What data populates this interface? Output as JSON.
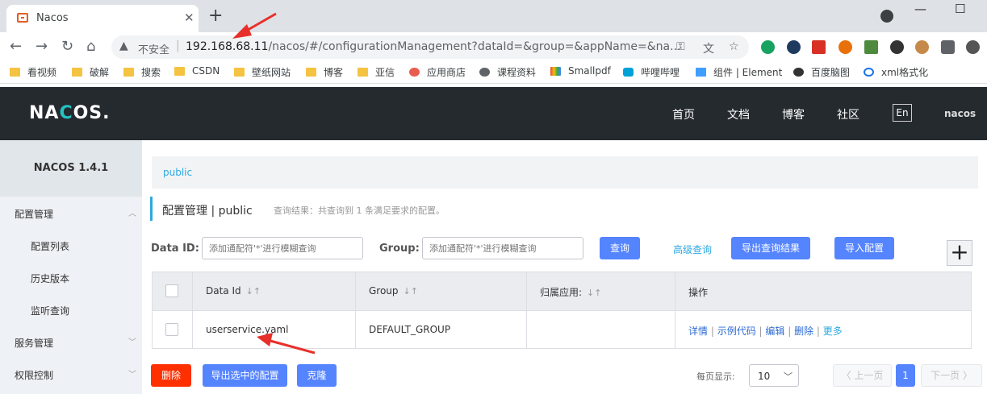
{
  "browser": {
    "tab_title": "Nacos",
    "tab_close": "✕",
    "new_tab": "+",
    "win_min": "—",
    "win_max": "☐",
    "nav": {
      "back": "←",
      "forward": "→",
      "reload": "↻",
      "home": "⌂"
    },
    "not_secure": "不安全",
    "url_host": "192.168.68.11",
    "url_rest": "/nacos/#/configurationManagement?dataId=&group=&appName=&na...",
    "bookmarks": [
      "看视频",
      "破解",
      "搜索",
      "CSDN",
      "壁纸网站",
      "博客",
      "亚信",
      "应用商店",
      "课程资料",
      "Smallpdf",
      "哔哩哔哩",
      "组件 | Element",
      "百度脑图",
      "xml格式化"
    ]
  },
  "header": {
    "logo_a": "NA",
    "logo_b": "C",
    "logo_c": "OS.",
    "nav": [
      "首页",
      "文档",
      "博客",
      "社区"
    ],
    "lang": "En",
    "user": "nacos"
  },
  "sidebar": {
    "title": "NACOS 1.4.1",
    "items": [
      {
        "label": "配置管理",
        "arrow": "︿"
      },
      {
        "label": "配置列表"
      },
      {
        "label": "历史版本"
      },
      {
        "label": "监听查询"
      },
      {
        "label": "服务管理",
        "arrow": "﹀"
      },
      {
        "label": "权限控制",
        "arrow": "﹀"
      }
    ]
  },
  "main": {
    "namespace": "public",
    "page_title": "配置管理 | public",
    "search_result": "查询结果：共查询到 1 条满足要求的配置。",
    "filter": {
      "dataid_label": "Data ID:",
      "dataid_placeholder": "添加通配符'*'进行模糊查询",
      "group_label": "Group:",
      "group_placeholder": "添加通配符'*'进行模糊查询",
      "query_btn": "查询",
      "advanced": "高级查询",
      "export_btn": "导出查询结果",
      "import_btn": "导入配置",
      "add_btn": "+"
    },
    "table": {
      "columns": [
        "Data Id",
        "Group",
        "归属应用:",
        "操作"
      ],
      "sort_icon": "↓↑",
      "rows": [
        {
          "data_id": "userservice.yaml",
          "group": "DEFAULT_GROUP",
          "app": "",
          "ops": [
            "详情",
            "示例代码",
            "编辑",
            "删除",
            "更多"
          ]
        }
      ]
    },
    "bulk": {
      "delete": "删除",
      "export_selected": "导出选中的配置",
      "clone": "克隆"
    },
    "pager": {
      "page_size_label": "每页显示:",
      "page_size": "10",
      "prev": "〈 上一页",
      "current": "1",
      "next": "下一页 〉"
    }
  },
  "colors": {
    "accent": "#5584ff",
    "danger": "#ff3000",
    "header_bg": "#252a2f",
    "annotation": "#e8302a"
  }
}
